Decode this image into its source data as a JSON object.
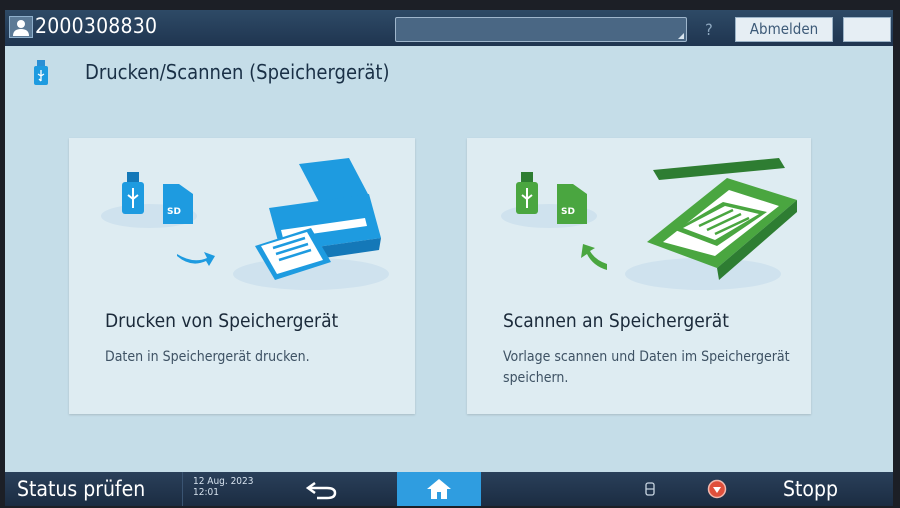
{
  "header": {
    "user_id": "2000308830",
    "help_label": "?",
    "logout_label": "Abmelden"
  },
  "page": {
    "title": "Drucken/Scannen (Speichergerät)"
  },
  "cards": [
    {
      "title": "Drucken von Speichergerät",
      "description": "Daten in Speichergerät drucken.",
      "sd_label": "SD"
    },
    {
      "title": "Scannen an Speichergerät",
      "description": "Vorlage scannen und Daten im Speichergerät speichern.",
      "sd_label": "SD"
    }
  ],
  "footer": {
    "status_label": "Status prüfen",
    "date": "12 Aug. 2023",
    "time": "12:01",
    "stop_label": "Stopp"
  },
  "colors": {
    "screen_bg": "#c5dde8",
    "print_accent": "#1e9be0",
    "scan_accent": "#4aa640",
    "home_active": "#2f9de0",
    "stop_red": "#e0503c"
  },
  "icons": [
    "user-icon",
    "help-icon",
    "moon-icon",
    "usb-icon",
    "sd-card-icon",
    "printer-icon",
    "scanner-icon",
    "back-arrow-icon",
    "home-icon",
    "storage-icon",
    "stop-icon"
  ]
}
